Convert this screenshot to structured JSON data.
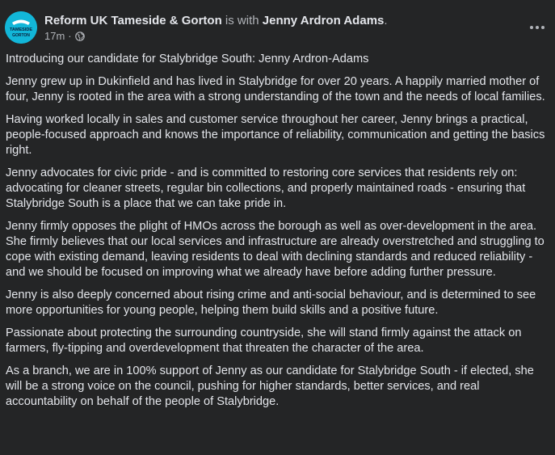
{
  "post": {
    "author": "Reform UK Tameside & Gorton",
    "with_text": "is with",
    "tagged": "Jenny Ardron Adams",
    "tagged_suffix": ".",
    "time": "17m",
    "separator": "·",
    "privacy_icon": "globe-icon",
    "more_icon": "more-options-icon",
    "avatar_text_top": "REFORM",
    "avatar_text_mid": "TAMESIDE",
    "avatar_text_bot": "GORTON",
    "avatar_color": "#12b6d8",
    "paragraphs": [
      "Introducing our candidate for Stalybridge South: Jenny Ardron-Adams",
      "Jenny grew up in Dukinfield and has lived in Stalybridge for over 20 years. A happily married mother of four, Jenny is rooted in the area with a strong understanding of the town and the needs of local families.",
      "Having worked locally in sales and customer service throughout her career, Jenny brings a practical, people-focused approach and knows the importance of reliability, communication and getting the basics right.",
      "Jenny advocates for civic pride - and is committed to restoring core services that residents rely on: advocating for cleaner streets, regular bin collections, and properly maintained roads - ensuring that Stalybridge South is a place that we can take pride in.",
      "Jenny firmly opposes the plight of HMOs across the borough as well as over-development in the area. She firmly believes that our local services and infrastructure are already overstretched and struggling to cope with existing demand, leaving residents to deal with declining standards and reduced reliability - and we should be focused on improving what we already have before adding further pressure.",
      "Jenny is also deeply concerned about rising crime and anti-social behaviour, and is determined to see more opportunities for young people, helping them build skills and a positive future.",
      "Passionate about protecting the surrounding countryside, she will stand firmly against the attack on farmers, fly-tipping and overdevelopment that threaten the character of the area.",
      "As a branch, we are in 100% support of Jenny as our candidate for Stalybridge South - if elected, she will be a strong voice on the council, pushing for higher standards, better services, and real accountability on behalf of the people of Stalybridge."
    ]
  }
}
